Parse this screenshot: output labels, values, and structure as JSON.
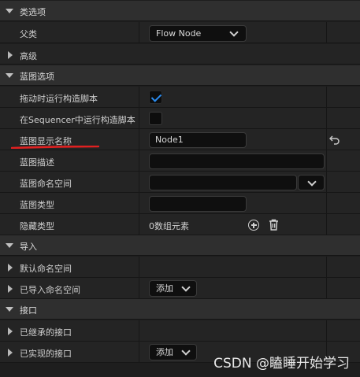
{
  "sections": {
    "class_options": "类选项",
    "advanced": "高级",
    "blueprint_options": "蓝图选项",
    "imports": "导入",
    "interfaces": "接口"
  },
  "class_options": {
    "parent_class_label": "父类",
    "parent_class_value": "Flow Node"
  },
  "blueprint_options": {
    "run_construction_on_drag_label": "拖动时运行构造脚本",
    "run_construction_on_drag_checked": true,
    "run_construction_in_sequencer_label": "在Sequencer中运行构造脚本",
    "run_construction_in_sequencer_checked": false,
    "display_name_label": "蓝图显示名称",
    "display_name_value": "Node1",
    "description_label": "蓝图描述",
    "description_value": "",
    "namespace_label": "蓝图命名空间",
    "namespace_value": "",
    "category_label": "蓝图类型",
    "category_value": "",
    "hide_categories_label": "隐藏类型",
    "hide_categories_value": "0数组元素"
  },
  "imports": {
    "default_namespaces_label": "默认命名空间",
    "imported_namespaces_label": "已导入命名空间",
    "add_label": "添加"
  },
  "interfaces": {
    "inherited_label": "已继承的接口",
    "implemented_label": "已实现的接口",
    "add_label": "添加"
  },
  "watermark": "CSDN @瞌睡开始学习",
  "colors": {
    "accent_check": "#2a8cf0",
    "annotation_underline": "#e02020"
  },
  "icons": [
    "expand-arrow-icon",
    "collapse-arrow-icon",
    "chevron-down-icon",
    "checkmark-icon",
    "add-element-icon",
    "trash-icon",
    "reset-to-default-icon"
  ]
}
